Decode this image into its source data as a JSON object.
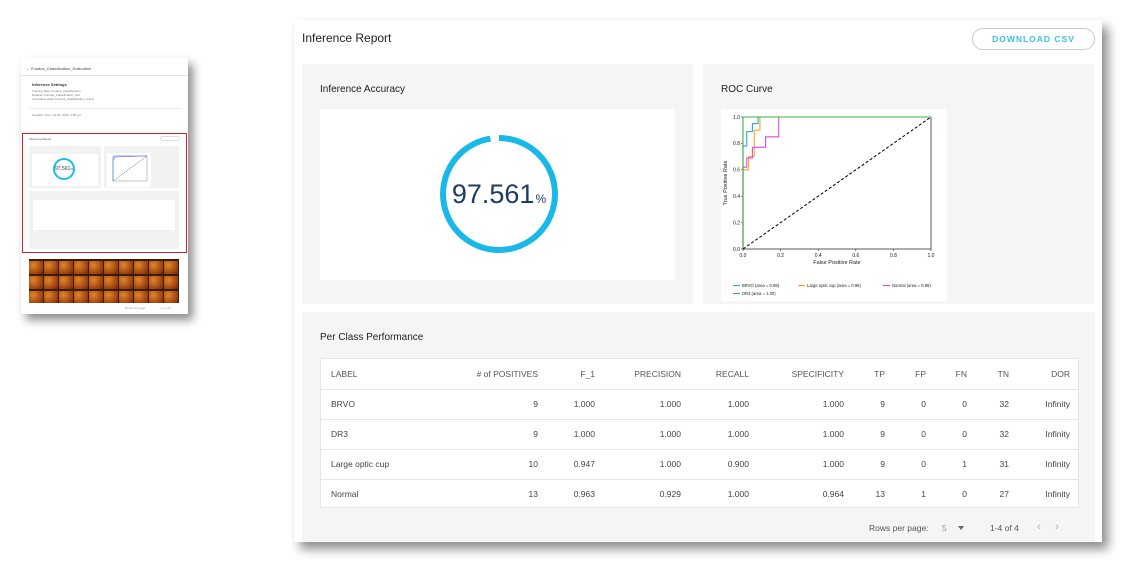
{
  "thumbnail": {
    "header": "←  Fundus_Classification_Evaluation",
    "settings_title": "Inference Settings",
    "settings_lines": [
      "Training Task: Fundus_Classification",
      "Dataset: Fundus_Classification_test",
      "Annotation Data: Fundus_Classification_test-A"
    ],
    "created": "Creation Time: Jul 30, 2020, 4:05 pm",
    "report_title": "Inference Report",
    "accuracy": "97.561",
    "pct": "%",
    "per_class_title": "Per Class Performance",
    "pager_text": "Rows per page: 5   1-4 of 4"
  },
  "report": {
    "title": "Inference Report",
    "download_label": "DOWNLOAD CSV"
  },
  "accuracy": {
    "title": "Inference Accuracy",
    "value": "97.561",
    "unit": "%",
    "fraction": 0.97561
  },
  "roc": {
    "title": "ROC Curve",
    "chart_data": {
      "type": "line",
      "xlabel": "False Positive Rate",
      "ylabel": "True Positive Rate",
      "xlim": [
        0.0,
        1.0
      ],
      "ylim": [
        0.0,
        1.0
      ],
      "ticks": [
        "0.0",
        "0.2",
        "0.4",
        "0.6",
        "0.8",
        "1.0"
      ],
      "legend_position": "below",
      "series": [
        {
          "name": "BRVO (area = 0.98)",
          "color": "#2ca7df",
          "x": [
            0,
            0,
            0.02,
            0.02,
            0.05,
            0.05,
            0.08,
            0.08,
            1.0
          ],
          "y": [
            0,
            0.78,
            0.78,
            0.89,
            0.89,
            0.95,
            0.95,
            1.0,
            1.0
          ]
        },
        {
          "name": "Large optic cup (area = 0.98)",
          "color": "#f5a623",
          "x": [
            0,
            0,
            0.03,
            0.03,
            0.06,
            0.06,
            0.09,
            0.09,
            1.0
          ],
          "y": [
            0,
            0.6,
            0.6,
            0.7,
            0.7,
            0.9,
            0.9,
            1.0,
            1.0
          ]
        },
        {
          "name": "Normal (area = 0.96)",
          "color": "#d94fd6",
          "x": [
            0,
            0,
            0.02,
            0.02,
            0.05,
            0.05,
            0.12,
            0.12,
            0.19,
            0.19,
            1.0
          ],
          "y": [
            0,
            0.62,
            0.62,
            0.69,
            0.69,
            0.77,
            0.77,
            0.85,
            0.85,
            1.0,
            1.0
          ]
        },
        {
          "name": "DR3 (area = 1.00)",
          "color": "#3cb043",
          "x": [
            0,
            0,
            1.0
          ],
          "y": [
            0,
            1.0,
            1.0
          ]
        },
        {
          "name": "",
          "color": "#000000",
          "dashed": true,
          "x": [
            0,
            1.0
          ],
          "y": [
            0,
            1.0
          ]
        }
      ]
    }
  },
  "performance": {
    "title": "Per Class Performance",
    "columns": [
      "LABEL",
      "# of POSITIVES",
      "F_1",
      "PRECISION",
      "RECALL",
      "SPECIFICITY",
      "TP",
      "FP",
      "FN",
      "TN",
      "DOR"
    ],
    "rows": [
      [
        "BRVO",
        "9",
        "1.000",
        "1.000",
        "1.000",
        "1.000",
        "9",
        "0",
        "0",
        "32",
        "Infinity"
      ],
      [
        "DR3",
        "9",
        "1.000",
        "1.000",
        "1.000",
        "1.000",
        "9",
        "0",
        "0",
        "32",
        "Infinity"
      ],
      [
        "Large optic cup",
        "10",
        "0.947",
        "1.000",
        "0.900",
        "1.000",
        "9",
        "0",
        "1",
        "31",
        "Infinity"
      ],
      [
        "Normal",
        "13",
        "0.963",
        "0.929",
        "1.000",
        "0.964",
        "13",
        "1",
        "0",
        "27",
        "Infinity"
      ]
    ],
    "rows_per_page_label": "Rows per page:",
    "rows_per_page_value": "5",
    "range": "1-4 of 4",
    "prev_icon": "‹",
    "next_icon": "›"
  }
}
